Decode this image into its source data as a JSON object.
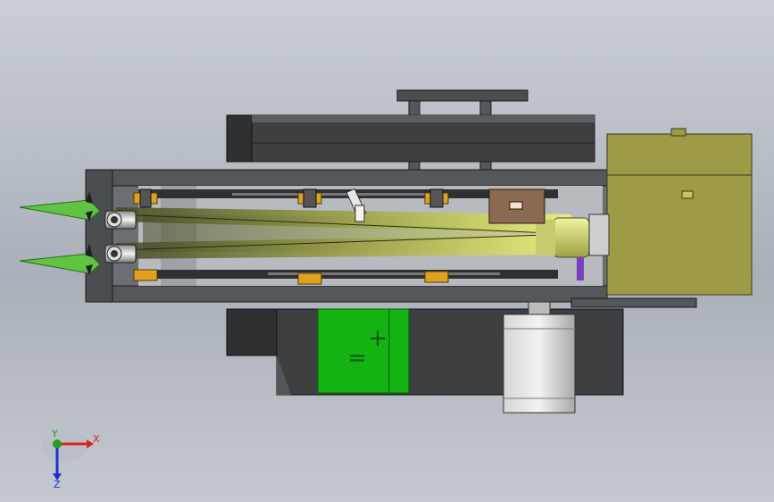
{
  "viewport": {
    "background_top": "#c9ced6",
    "background_bottom": "#c5c9cf",
    "colors": {
      "frame_dark": "#3d3f41",
      "frame_mid": "#55585b",
      "frame_light": "#8d9094",
      "motor_housing": "#9e9b47",
      "battery_green": "#14b314",
      "belt_olive": "#8a8a3a",
      "belt_glow": "#e6f27a",
      "bearing_orange": "#e0a020",
      "blade_green": "#5fc442",
      "motor_silver": "#c8c8c8",
      "purple_bar": "#7b3fc2"
    }
  },
  "battery": {
    "symbols": [
      "+",
      "="
    ]
  },
  "triad": {
    "x_label": "X",
    "y_label": "Y",
    "z_label": "Z",
    "x_color": "#e02020",
    "y_color": "#20a020",
    "z_color": "#2030d0"
  }
}
